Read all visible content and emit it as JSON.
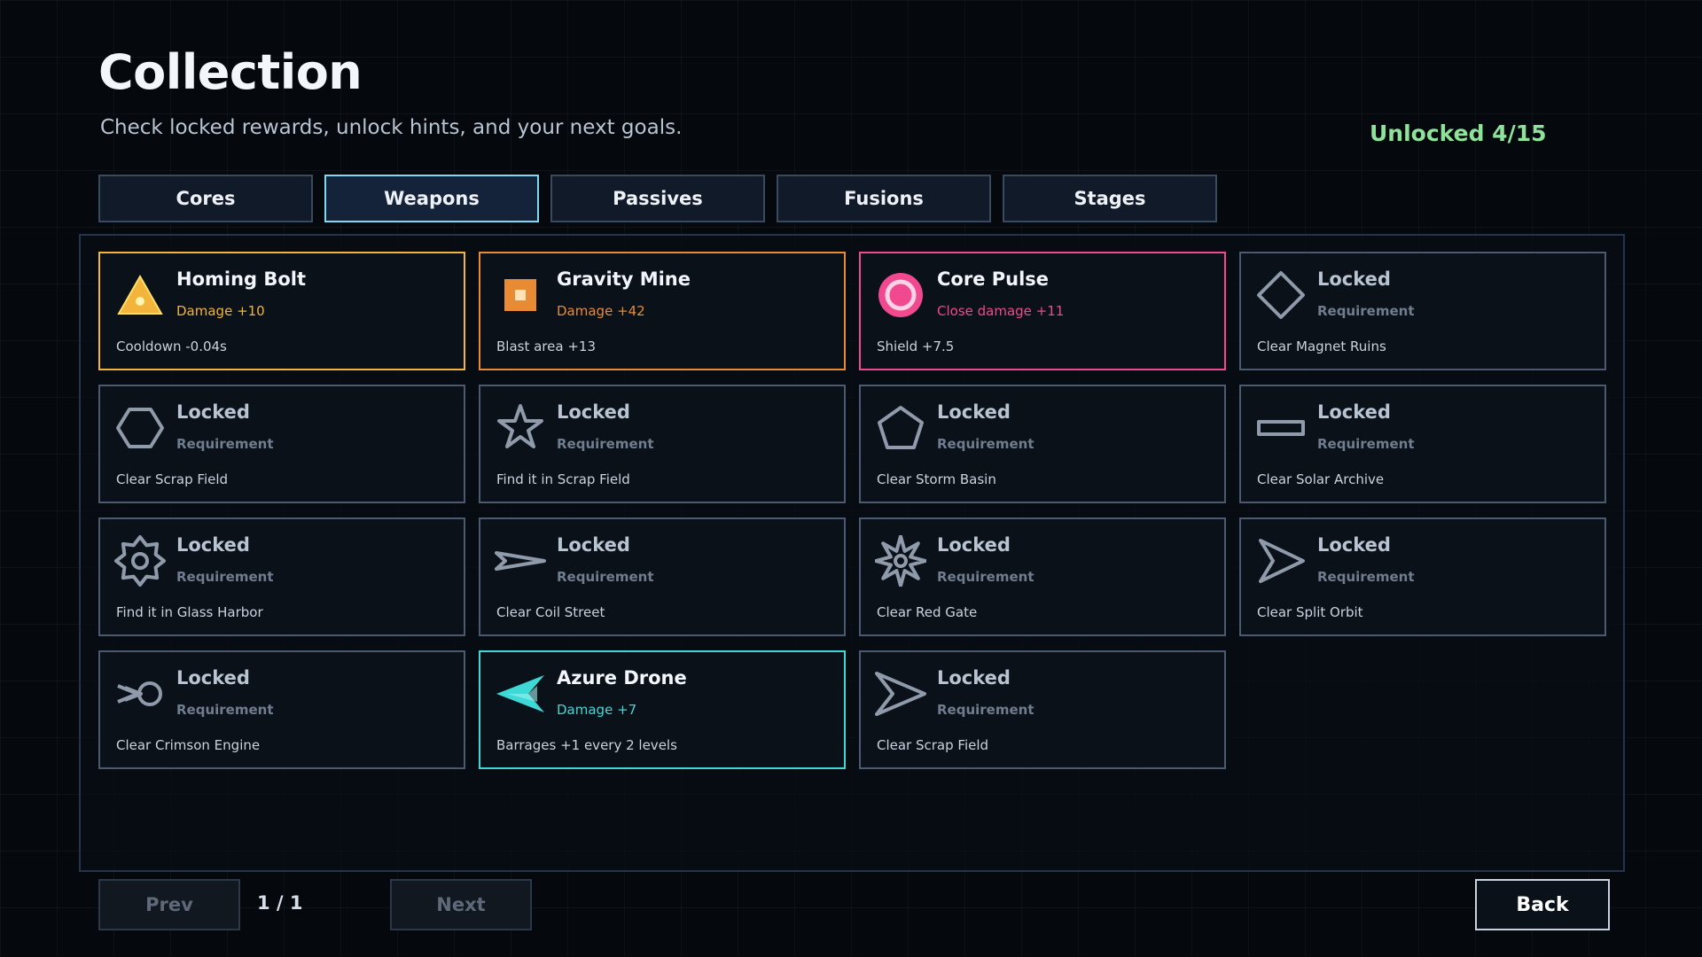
{
  "header": {
    "title": "Collection",
    "subtitle": "Check locked rewards, unlock hints, and your next goals.",
    "unlocked_count": "Unlocked 4/15"
  },
  "tabs": [
    {
      "label": "Cores",
      "active": false
    },
    {
      "label": "Weapons",
      "active": true
    },
    {
      "label": "Passives",
      "active": false
    },
    {
      "label": "Fusions",
      "active": false
    },
    {
      "label": "Stages",
      "active": false
    }
  ],
  "items": [
    {
      "name": "Homing Bolt",
      "stat": "Damage +10",
      "desc": "Cooldown -0.04s",
      "locked": false,
      "icon": "triangle-icon",
      "color": "#f2b43a"
    },
    {
      "name": "Gravity Mine",
      "stat": "Damage +42",
      "desc": "Blast area +13",
      "locked": false,
      "icon": "mine-square-icon",
      "color": "#e98a35"
    },
    {
      "name": "Core Pulse",
      "stat": "Close damage +11",
      "desc": "Shield +7.5",
      "locked": false,
      "icon": "pulse-ring-icon",
      "color": "#f0498f"
    },
    {
      "name": "Locked",
      "stat": "Requirement",
      "desc": "Clear Magnet Ruins",
      "locked": true,
      "icon": "diamond-icon",
      "color": "#8f9bab"
    },
    {
      "name": "Locked",
      "stat": "Requirement",
      "desc": "Clear Scrap Field",
      "locked": true,
      "icon": "hexagon-icon",
      "color": "#8f9bab"
    },
    {
      "name": "Locked",
      "stat": "Requirement",
      "desc": "Find it in Scrap Field",
      "locked": true,
      "icon": "star-icon",
      "color": "#8f9bab"
    },
    {
      "name": "Locked",
      "stat": "Requirement",
      "desc": "Clear Storm Basin",
      "locked": true,
      "icon": "pentagon-icon",
      "color": "#8f9bab"
    },
    {
      "name": "Locked",
      "stat": "Requirement",
      "desc": "Clear Solar Archive",
      "locked": true,
      "icon": "bar-icon",
      "color": "#8f9bab"
    },
    {
      "name": "Locked",
      "stat": "Requirement",
      "desc": "Find it in Glass Harbor",
      "locked": true,
      "icon": "gear-icon",
      "color": "#8f9bab"
    },
    {
      "name": "Locked",
      "stat": "Requirement",
      "desc": "Clear Coil Street",
      "locked": true,
      "icon": "dart-icon",
      "color": "#8f9bab"
    },
    {
      "name": "Locked",
      "stat": "Requirement",
      "desc": "Clear Red Gate",
      "locked": true,
      "icon": "spike-burst-icon",
      "color": "#8f9bab"
    },
    {
      "name": "Locked",
      "stat": "Requirement",
      "desc": "Clear Split Orbit",
      "locked": true,
      "icon": "arrowhead-icon",
      "color": "#8f9bab"
    },
    {
      "name": "Locked",
      "stat": "Requirement",
      "desc": "Clear Crimson Engine",
      "locked": true,
      "icon": "engine-icon",
      "color": "#8f9bab"
    },
    {
      "name": "Azure Drone",
      "stat": "Damage +7",
      "desc": "Barrages +1 every 2 levels",
      "locked": false,
      "icon": "drone-icon",
      "color": "#3ed8d6"
    },
    {
      "name": "Locked",
      "stat": "Requirement",
      "desc": "Clear Scrap Field",
      "locked": true,
      "icon": "chevron-ship-icon",
      "color": "#8f9bab"
    }
  ],
  "pagination": {
    "prev_label": "Prev",
    "page_indicator": "1 / 1",
    "next_label": "Next"
  },
  "back_label": "Back"
}
